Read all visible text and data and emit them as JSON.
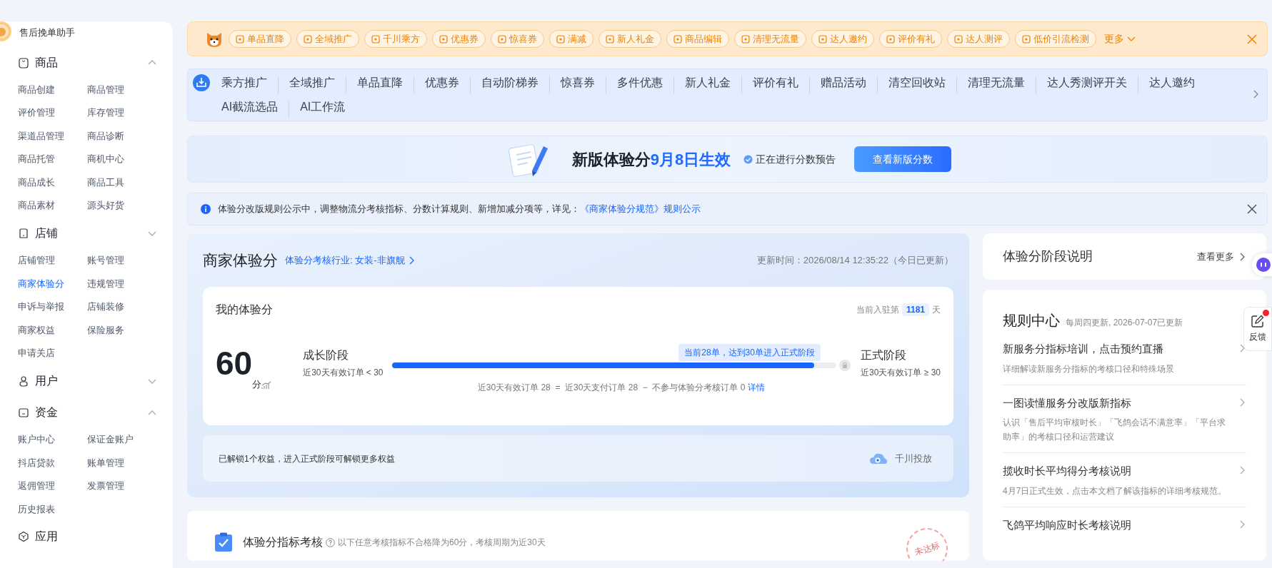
{
  "sidebar": {
    "helper": "售后挽单助手",
    "groups": [
      {
        "title": "商品",
        "expanded": true,
        "items": [
          {
            "label": "商品创建",
            "selected": false
          },
          {
            "label": "商品管理",
            "selected": false
          },
          {
            "label": "评价管理",
            "selected": false
          },
          {
            "label": "库存管理",
            "selected": false
          },
          {
            "label": "渠道品管理",
            "selected": false
          },
          {
            "label": "商品诊断",
            "selected": false
          },
          {
            "label": "商品托管",
            "selected": false
          },
          {
            "label": "商机中心",
            "selected": false
          },
          {
            "label": "商品成长",
            "selected": false
          },
          {
            "label": "商品工具",
            "selected": false
          },
          {
            "label": "商品素材",
            "selected": false
          },
          {
            "label": "源头好货",
            "selected": false
          }
        ]
      },
      {
        "title": "店铺",
        "expanded": false,
        "items": [
          {
            "label": "店铺管理",
            "selected": false
          },
          {
            "label": "账号管理",
            "selected": false
          },
          {
            "label": "商家体验分",
            "selected": true
          },
          {
            "label": "违规管理",
            "selected": false
          },
          {
            "label": "申诉与举报",
            "selected": false
          },
          {
            "label": "店铺装修",
            "selected": false
          },
          {
            "label": "商家权益",
            "selected": false
          },
          {
            "label": "保险服务",
            "selected": false
          },
          {
            "label": "申请关店",
            "selected": false
          }
        ]
      },
      {
        "title": "用户",
        "expanded": false
      },
      {
        "title": "资金",
        "expanded": true,
        "items": [
          {
            "label": "账户中心",
            "selected": false
          },
          {
            "label": "保证金账户",
            "selected": false
          },
          {
            "label": "抖店贷款",
            "selected": false
          },
          {
            "label": "账单管理",
            "selected": false
          },
          {
            "label": "返佣管理",
            "selected": false
          },
          {
            "label": "发票管理",
            "selected": false
          },
          {
            "label": "历史报表",
            "selected": false
          }
        ]
      },
      {
        "title": "应用"
      }
    ]
  },
  "quick_bar": {
    "items": [
      "单品直降",
      "全域推广",
      "千川乘方",
      "优惠券",
      "惊喜券",
      "满减",
      "新人礼金",
      "商品编辑",
      "清理无流量",
      "达人邀约",
      "评价有礼",
      "达人测评",
      "低价引流检测"
    ],
    "more": "更多"
  },
  "nav_links": [
    "乘方推广",
    "全域推广",
    "单品直降",
    "优惠券",
    "自动阶梯券",
    "惊喜券",
    "多件优惠",
    "新人礼金",
    "评价有礼",
    "赠品活动",
    "清空回收站",
    "清理无流量",
    "达人秀测评开关",
    "达人邀约",
    "AI截流选品",
    "AI工作流"
  ],
  "banner": {
    "title": "新版体验分",
    "highlight": "9月8日生效",
    "status": "正在进行分数预告",
    "button": "查看新版分数"
  },
  "notice": {
    "text": "体验分改版规则公示中，调整物流分考核指标、分数计算规则、新增加减分项等，详见：",
    "link": "《商家体验分规范》规则公示"
  },
  "score_panel": {
    "title": "商家体验分",
    "industry": "体验分考核行业: 女装-非旗舰",
    "updated": "更新时间：2026/08/14 12:35:22（今日已更新）",
    "card": {
      "title": "我的体验分",
      "days_prefix": "当前入驻第",
      "days": "1181",
      "days_suffix": "天",
      "score": "60",
      "unit": "分",
      "current_stage": {
        "name": "成长阶段",
        "condition": "近30天有效订单 < 30"
      },
      "next_stage": {
        "name": "正式阶段",
        "condition": "近30天有效订单 ≥ 30"
      },
      "progress": {
        "level": 0.95,
        "tooltip": "当前28单，达到30单进入正式阶段",
        "formula": "近30天有效订单 28  =  近30天支付订单 28  −  不参与体验分考核订单 0",
        "detail_link": "详情"
      }
    },
    "benefits": {
      "text": "已解锁1个权益，进入正式阶段可解锁更多权益",
      "channel": "千川投放"
    }
  },
  "metrics": {
    "title": "体验分指标考核",
    "hint": "以下任意考核指标不合格降为60分，考核周期为近30天",
    "stamp": "未达标"
  },
  "stage_info": {
    "title": "体验分阶段说明",
    "more": "查看更多"
  },
  "rule_center": {
    "title": "规则中心",
    "subtitle": "每周四更新, 2026-07-07已更新",
    "articles": [
      {
        "title": "新服务分指标培训，点击预约直播",
        "desc": "详细解读新服务分指标的考核口径和特殊场景"
      },
      {
        "title": "一图读懂服务分改版新指标",
        "desc": "认识「售后平均审核时长」「飞鸽会话不满意率」「平台求助率」的考核口径和运营建议"
      },
      {
        "title": "揽收时长平均得分考核说明",
        "desc": "4月7日正式生效，点击本文档了解该指标的详细考核规范。"
      },
      {
        "title": "飞鸽平均响应时长考核说明"
      }
    ]
  },
  "feedback": {
    "label": "反馈",
    "unread": true
  }
}
